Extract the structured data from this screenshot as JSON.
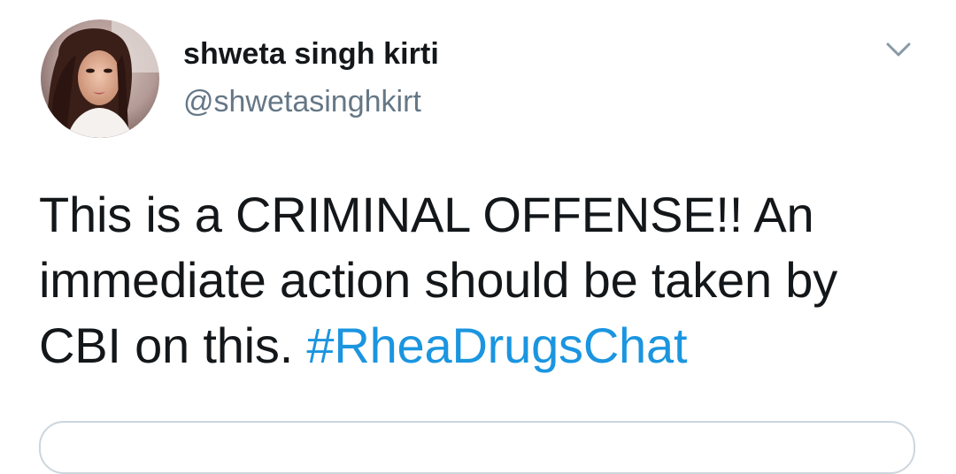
{
  "author": {
    "display_name": "shweta singh kirti",
    "handle": "@shwetasinghkirt"
  },
  "tweet": {
    "text_before": "This is a CRIMINAL OFFENSE!! An immediate action should be taken by CBI on this.",
    "hashtag": "#RheaDrugsChat"
  },
  "icons": {
    "menu": "chevron-down-icon"
  },
  "colors": {
    "text": "#14171a",
    "secondary": "#657786",
    "link": "#1b95e0",
    "border": "#ccd6dd"
  }
}
